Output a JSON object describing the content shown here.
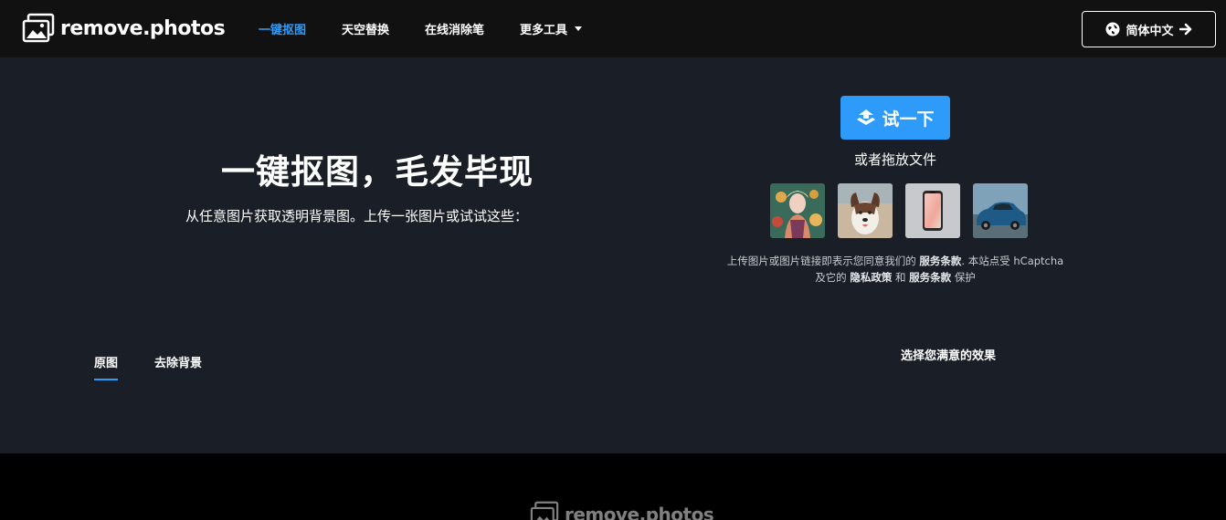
{
  "brand": {
    "name": "remove.photos",
    "icon": "photos-logo-icon"
  },
  "nav": {
    "items": [
      {
        "label": "一键抠图",
        "active": true
      },
      {
        "label": "天空替换",
        "active": false
      },
      {
        "label": "在线消除笔",
        "active": false
      },
      {
        "label": "更多工具",
        "active": false,
        "dropdown": true
      }
    ],
    "language": {
      "label": "简体中文",
      "icon": "globe-icon",
      "arrow_icon": "arrow-right-icon"
    }
  },
  "hero": {
    "title": "一键抠图，毛发毕现",
    "subtitle": "从任意图片获取透明背景图。上传一张图片或试试这些："
  },
  "upload": {
    "button_label": "试一下",
    "button_icon": "upload-stack-icon",
    "drop_text": "或者拖放文件"
  },
  "samples": [
    {
      "name": "sample-portrait"
    },
    {
      "name": "sample-dog"
    },
    {
      "name": "sample-phone"
    },
    {
      "name": "sample-car"
    }
  ],
  "legal": {
    "part1": "上传图片或图片链接即表示您同意我们的",
    "terms": "服务条款",
    "part2": ". 本站点受 hCaptcha",
    "part3": "及它的",
    "privacy": "隐私政策",
    "and": "和",
    "terms2": "服务条款",
    "part4": "保护"
  },
  "tabs": [
    {
      "label": "原图",
      "active": true
    },
    {
      "label": "去除背景",
      "active": false
    }
  ],
  "choose_text": "选择您满意的效果",
  "footer": {
    "brand": "remove.photos"
  },
  "colors": {
    "accent": "#2e9bfa",
    "bg": "#1a1f27",
    "nav_bg": "#111112",
    "footer_bg": "#000000"
  }
}
